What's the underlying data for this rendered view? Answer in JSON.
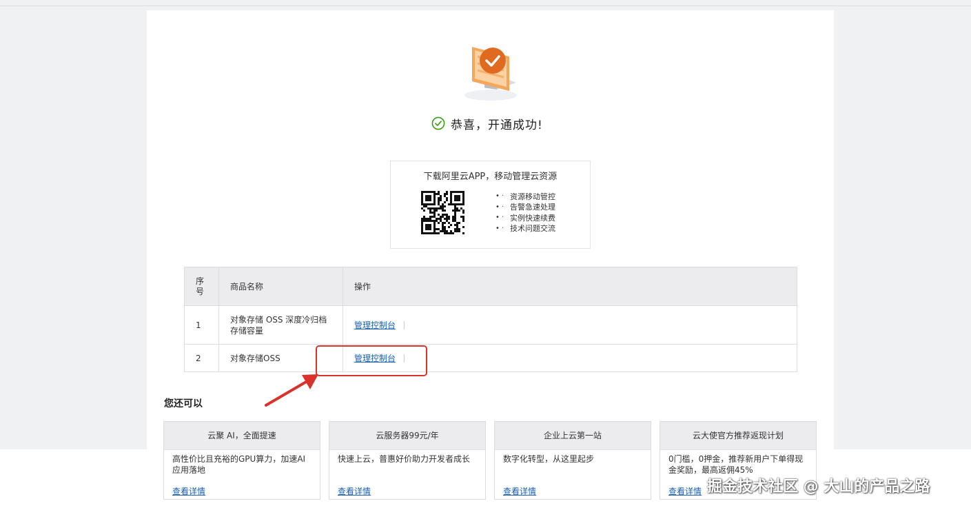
{
  "hero": {
    "icon": "monitor-check-icon"
  },
  "status": {
    "message": "恭喜，开通成功!",
    "icon": "check-circle-icon",
    "color": "#389e0d"
  },
  "app_promo": {
    "title": "下载阿里云APP，移动管理云资源",
    "features": [
      "资源移动管控",
      "告警急速处理",
      "实例快速续费",
      "技术问题交流"
    ],
    "qr": "qr-code-icon"
  },
  "table": {
    "headers": {
      "seq": "序号",
      "name": "商品名称",
      "action": "操作"
    },
    "rows": [
      {
        "seq": "1",
        "name": "对象存储 OSS 深度冷归档存储容量",
        "action": "管理控制台"
      },
      {
        "seq": "2",
        "name": "对象存储OSS",
        "action": "管理控制台"
      }
    ]
  },
  "more": {
    "title": "您还可以",
    "cards": [
      {
        "title": "云聚 AI，全面提速",
        "desc": "高性价比且充裕的GPU算力，加速AI应用落地",
        "link": "查看详情"
      },
      {
        "title": "云服务器99元/年",
        "desc": "快速上云，普惠好价助力开发者成长",
        "link": "查看详情"
      },
      {
        "title": "企业上云第一站",
        "desc": "数字化转型，从这里起步",
        "link": "查看详情"
      },
      {
        "title": "云大使官方推荐返现计划",
        "desc": "0门槛，0押金，推荐新用户下单得现金奖励，最高返佣45%",
        "link": "查看详情"
      }
    ]
  },
  "watermark": "掘金技术社区 @ 大山的产品之路",
  "colors": {
    "accent": "#1a5fb4",
    "annotation": "#d9322b",
    "hero": "#e8742a"
  }
}
